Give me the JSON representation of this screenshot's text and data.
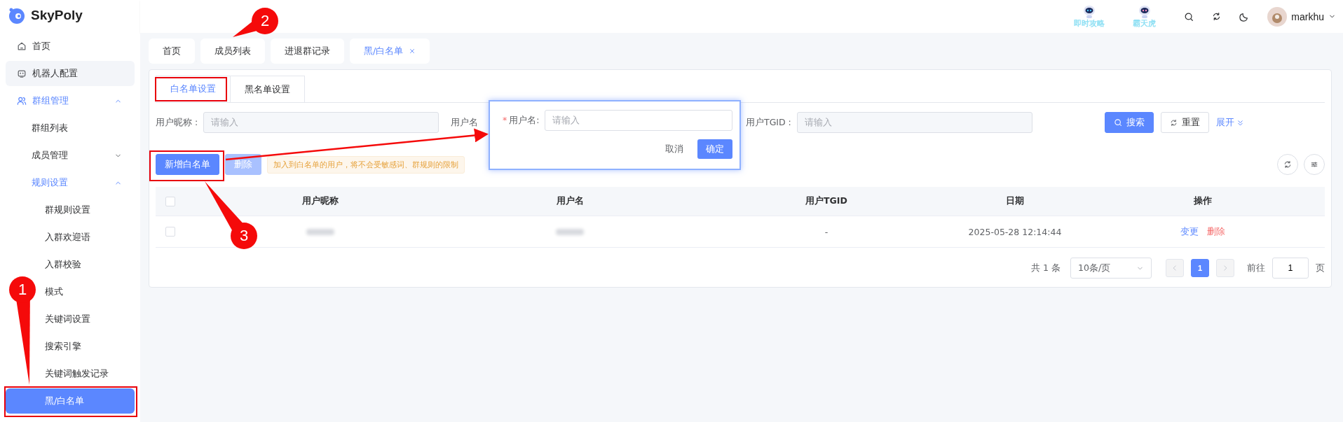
{
  "app": {
    "name": "SkyPoly"
  },
  "header": {
    "promos": [
      {
        "label": "即时攻略"
      },
      {
        "label": "霸天虎"
      }
    ],
    "user": {
      "name": "markhu"
    }
  },
  "sidebar": {
    "items": [
      {
        "label": "首页",
        "selected": false
      },
      {
        "label": "机器人配置",
        "selected": false,
        "hovered": true
      },
      {
        "label": "群组管理",
        "selected": false,
        "expanded": true,
        "children": [
          {
            "label": "群组列表",
            "selected": false
          },
          {
            "label": "成员管理",
            "selected": false,
            "expanded": false
          },
          {
            "label": "规则设置",
            "selected": false,
            "expanded": true,
            "children": [
              {
                "label": "群规则设置",
                "selected": false
              },
              {
                "label": "入群欢迎语",
                "selected": false
              },
              {
                "label": "入群校验",
                "selected": false
              },
              {
                "label": "模式",
                "selected": false
              },
              {
                "label": "关键词设置",
                "selected": false
              },
              {
                "label": "搜索引擎",
                "selected": false
              },
              {
                "label": "关键词触发记录",
                "selected": false
              },
              {
                "label": "黑/白名单",
                "selected": true
              }
            ]
          }
        ]
      }
    ]
  },
  "tabs": [
    {
      "label": "首页",
      "selected": false,
      "closable": false
    },
    {
      "label": "成员列表",
      "selected": false,
      "closable": false
    },
    {
      "label": "进退群记录",
      "selected": false,
      "closable": false
    },
    {
      "label": "黑/白名单",
      "selected": true,
      "closable": true
    }
  ],
  "subtabs": [
    {
      "label": "白名单设置",
      "selected": true
    },
    {
      "label": "黑名单设置",
      "selected": false
    }
  ],
  "filters": [
    {
      "label": "用户昵称 :",
      "placeholder": "请输入"
    },
    {
      "label": "用户名"
    },
    {
      "label": "用户TGID :",
      "placeholder": "请输入"
    }
  ],
  "filter_buttons": {
    "search": "搜索",
    "reset": "重置",
    "expand": "展开"
  },
  "actions": [
    {
      "label": "新增白名单",
      "disabled": false
    },
    {
      "label": "删除",
      "disabled": true
    }
  ],
  "notice": "加入到白名单的用户，将不会受敏感词、群规则的限制",
  "table": {
    "header_checked": false,
    "columns": [
      "用户昵称",
      "用户名",
      "用户TGID",
      "日期",
      "操作"
    ],
    "rows": [
      {
        "checked": false,
        "tgid": "-",
        "date": "2025-05-28 12:14:44",
        "actions": [
          {
            "label": "变更",
            "kind": "edit"
          },
          {
            "label": "删除",
            "kind": "danger"
          }
        ]
      }
    ]
  },
  "pagination": {
    "total": "共 1 条",
    "page_size": "10条/页",
    "pages": [
      {
        "label": "1",
        "selected": true
      }
    ],
    "goto_label": "前往",
    "goto_value": "1",
    "suffix": "页"
  },
  "popup": {
    "label": "用户名:",
    "required_mark": "*",
    "placeholder": "请输入",
    "buttons": [
      {
        "label": "取消",
        "kind": "text"
      },
      {
        "label": "确定",
        "kind": "primary"
      }
    ]
  },
  "annotations": [
    {
      "number": "1"
    },
    {
      "number": "2"
    },
    {
      "number": "3"
    }
  ]
}
